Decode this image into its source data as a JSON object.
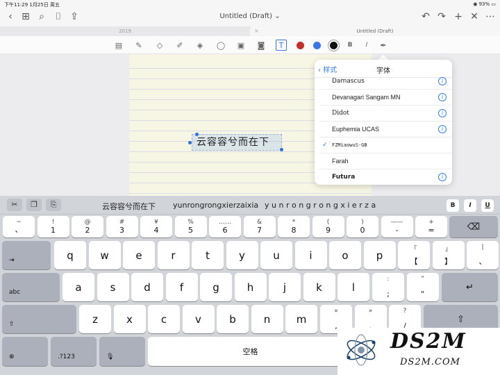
{
  "status": {
    "time": "下午11:29",
    "date": "1月25日 周五",
    "battery": "93%"
  },
  "nav": {
    "title": "Untitled (Draft)"
  },
  "tabs": {
    "left": "2019",
    "right": "Untitled (Draft)",
    "close": "×"
  },
  "toolbar": {
    "bold": "B",
    "italic": "I",
    "colors": {
      "red": "#c2302a",
      "blue": "#3a76e5",
      "black": "#111111"
    }
  },
  "document": {
    "handwriting": "云容容兮而在下"
  },
  "font_popover": {
    "back_label": "样式",
    "title": "字体",
    "fonts": [
      {
        "name": "Damascus",
        "info": true,
        "selected": false
      },
      {
        "name": "Devanagari Sangam MN",
        "info": true,
        "selected": false
      },
      {
        "name": "Didot",
        "info": true,
        "selected": false
      },
      {
        "name": "Euphemia UCAS",
        "info": true,
        "selected": false
      },
      {
        "name": "FZMiaowuS-GB",
        "info": false,
        "selected": true
      },
      {
        "name": "Farah",
        "info": false,
        "selected": false
      },
      {
        "name": "Futura",
        "info": true,
        "selected": false
      }
    ],
    "info_glyph": "i",
    "check_glyph": "✓"
  },
  "keyboard": {
    "suggestions": [
      "云容容兮而在下",
      "yunrongrongxierzaixia",
      "y u n r o n g r o n g x i e r z a"
    ],
    "format": {
      "bold": "B",
      "italic": "I",
      "underline": "U"
    },
    "row1": [
      {
        "top": "~",
        "bot": "、"
      },
      {
        "top": "!",
        "bot": "1"
      },
      {
        "top": "@",
        "bot": "2"
      },
      {
        "top": "#",
        "bot": "3"
      },
      {
        "top": "¥",
        "bot": "4"
      },
      {
        "top": "%",
        "bot": "5"
      },
      {
        "top": "……",
        "bot": "6"
      },
      {
        "top": "&",
        "bot": "7"
      },
      {
        "top": "*",
        "bot": "8"
      },
      {
        "top": "(",
        "bot": "9"
      },
      {
        "top": ")",
        "bot": "0"
      },
      {
        "top": "——",
        "bot": "-"
      },
      {
        "top": "+",
        "bot": "="
      }
    ],
    "row2": [
      "q",
      "w",
      "e",
      "r",
      "t",
      "y",
      "u",
      "i",
      "o",
      "p"
    ],
    "row2_extra": [
      {
        "top": "「",
        "bot": "【"
      },
      {
        "top": "」",
        "bot": "】"
      },
      {
        "top": "|",
        "bot": "、"
      }
    ],
    "row3": [
      "a",
      "s",
      "d",
      "f",
      "g",
      "h",
      "j",
      "k",
      "l"
    ],
    "row3_extra": [
      {
        "top": ":",
        "bot": ";"
      },
      {
        "top": "”",
        "bot": "“"
      }
    ],
    "row4": [
      "z",
      "x",
      "c",
      "v",
      "b",
      "n",
      "m"
    ],
    "row4_extra": [
      {
        "top": "«",
        "bot": ","
      },
      {
        "top": "»",
        "bot": "."
      },
      {
        "top": "?",
        "bot": "/"
      }
    ],
    "tab_label": "⇥",
    "abc_label": "abc",
    "shift_label": "⇧",
    "globe_label": "⊕",
    "num_label": ".?123",
    "mic_label": "🎙",
    "space_label": "空格",
    "backspace_label": "⌫",
    "return_label": "↵"
  },
  "watermark": {
    "title": "DS2M",
    "subtitle": "DS2M.COM"
  }
}
